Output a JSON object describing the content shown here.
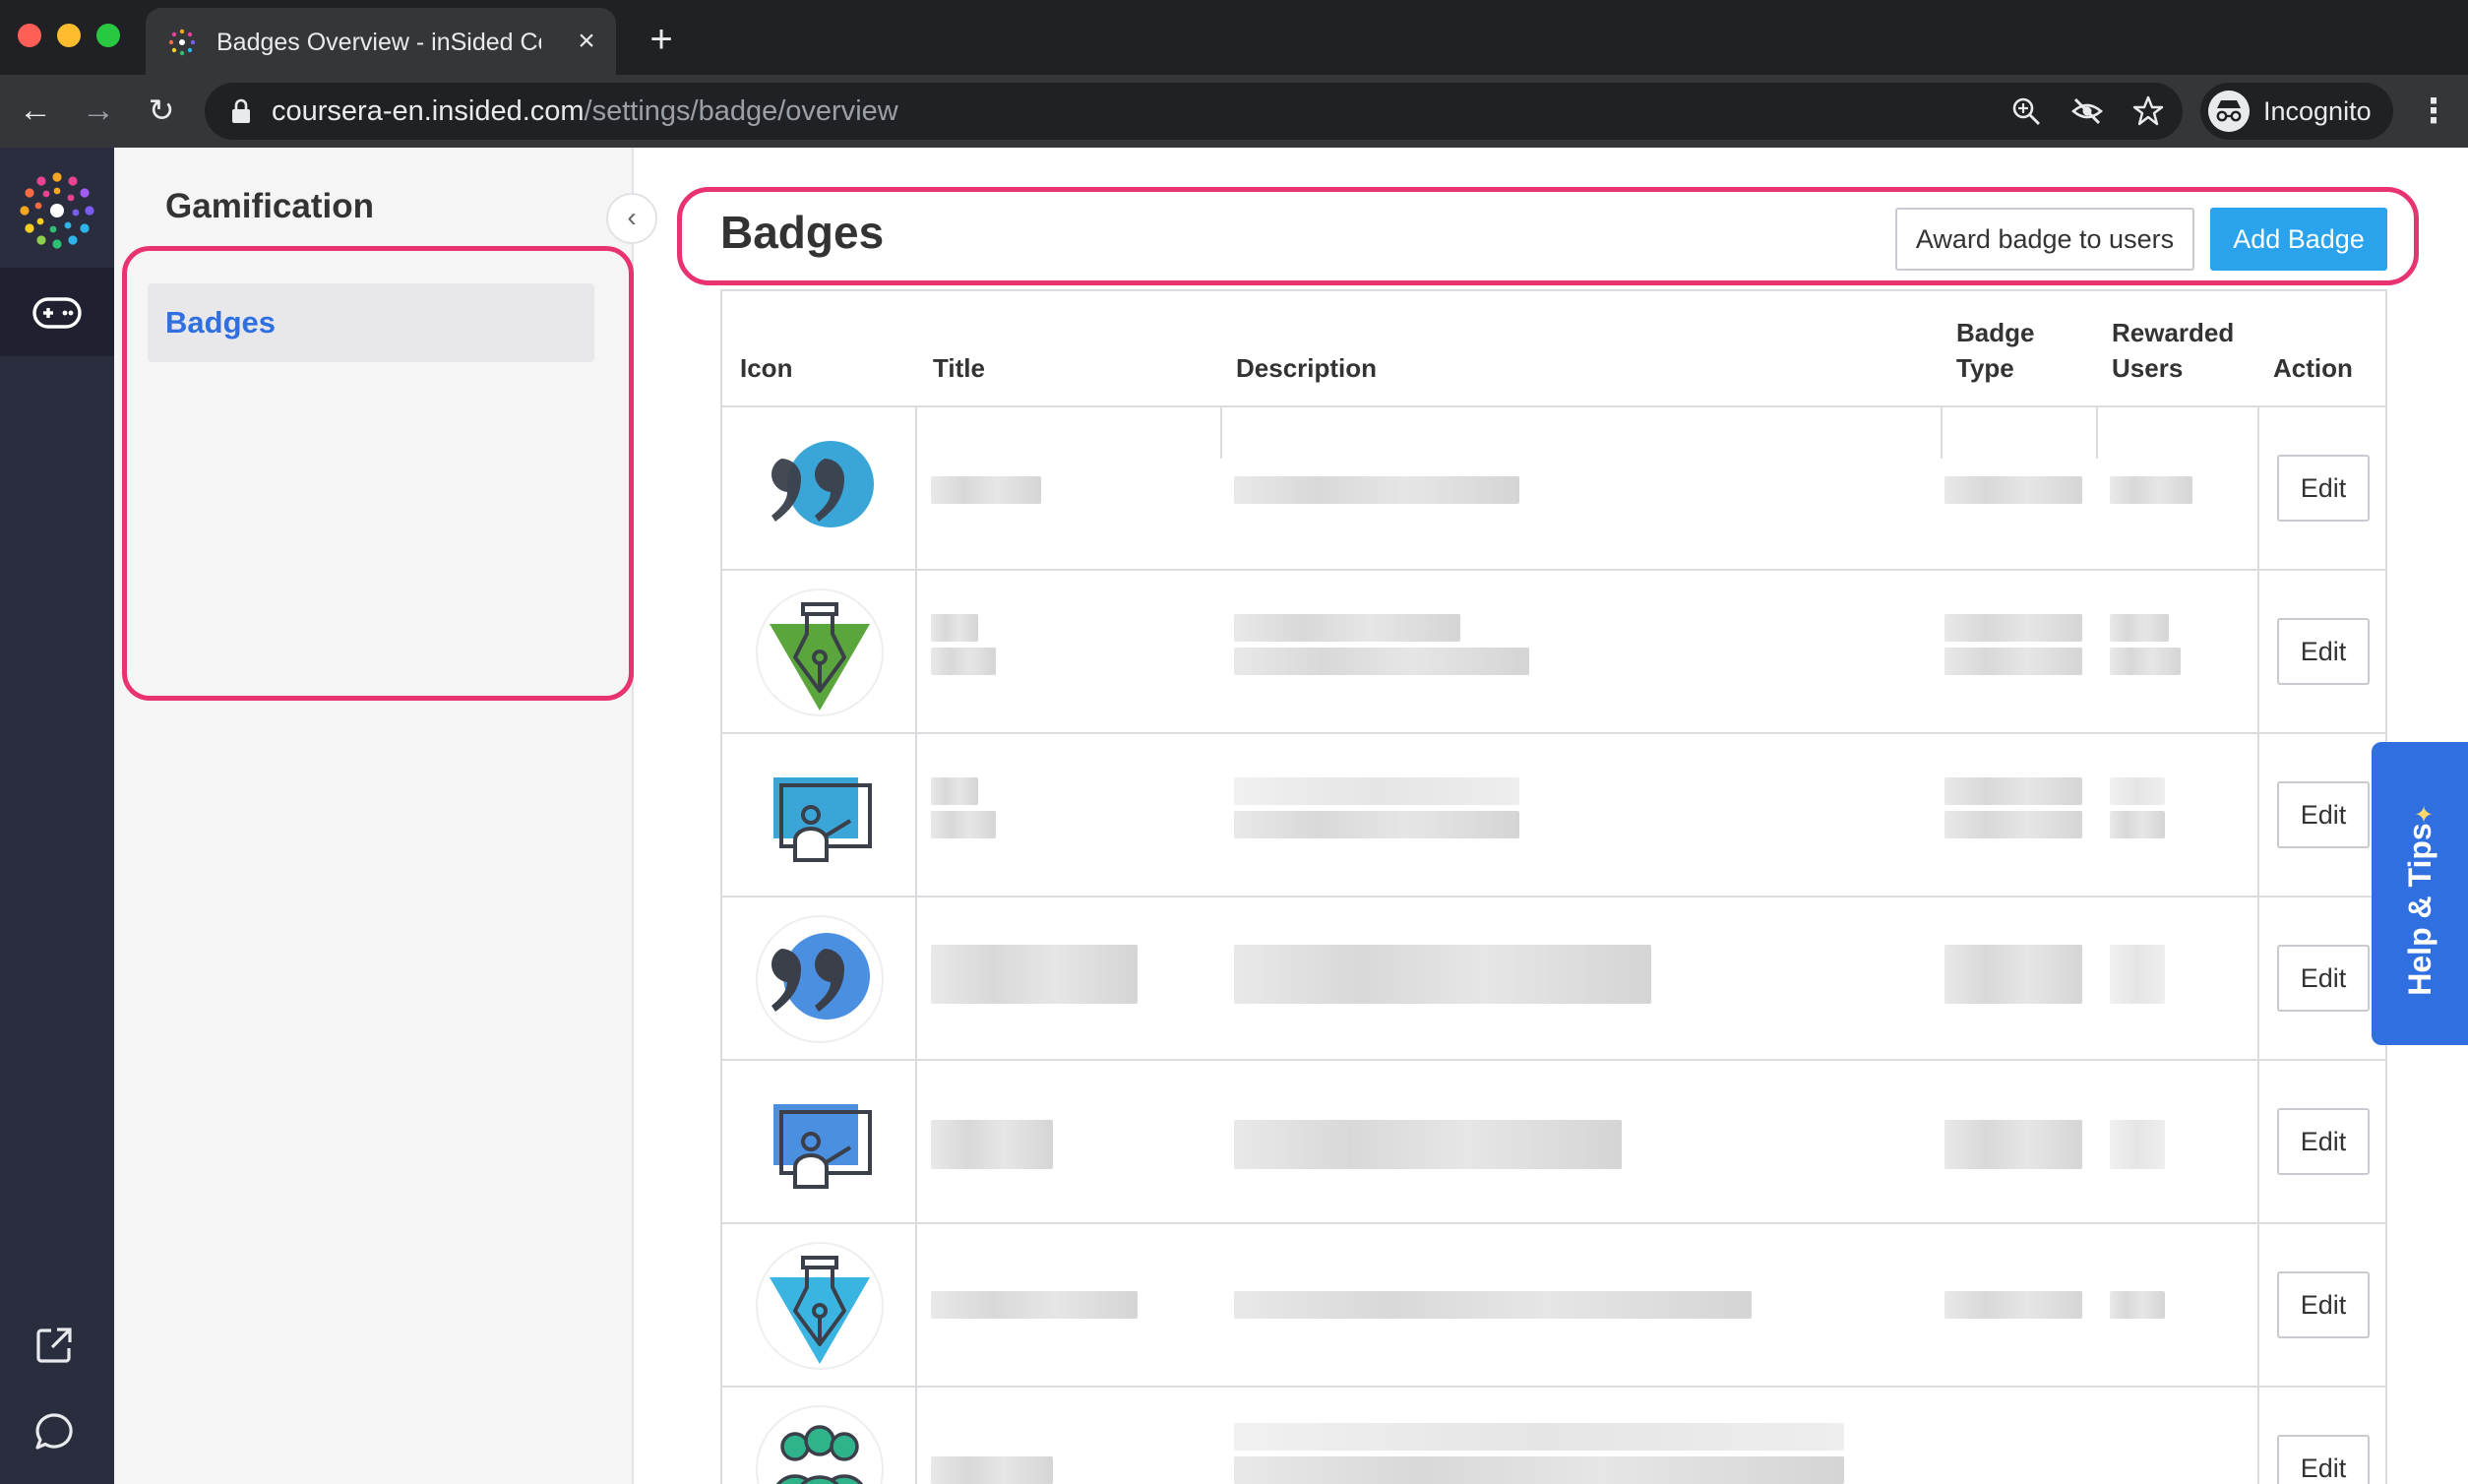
{
  "browser": {
    "tab_title": "Badges Overview - inSided Co",
    "url_host": "coursera-en.insided.com",
    "url_path": "/settings/badge/overview",
    "profile_label": "Incognito"
  },
  "sidebar": {
    "section_title": "Gamification",
    "items": [
      {
        "label": "Badges"
      }
    ]
  },
  "main": {
    "title": "Badges",
    "award_button": "Award badge to users",
    "add_button": "Add Badge"
  },
  "table": {
    "columns": {
      "icon": "Icon",
      "title": "Title",
      "description": "Description",
      "badge_type": "Badge Type",
      "rewarded_users": "Rewarded Users",
      "action": "Action"
    },
    "rows": [
      {
        "icon": "quote-bubble-icon",
        "badge_color": "#3aa6d8",
        "edit_label": "Edit"
      },
      {
        "icon": "pen-nib-icon",
        "badge_color": "#5aa63c",
        "edit_label": "Edit"
      },
      {
        "icon": "presentation-board-icon",
        "badge_color": "#3aa6d8",
        "edit_label": "Edit"
      },
      {
        "icon": "quote-bubble-icon",
        "badge_color": "#4a8fe0",
        "edit_label": "Edit"
      },
      {
        "icon": "presentation-board-icon",
        "badge_color": "#4a8fe0",
        "edit_label": "Edit"
      },
      {
        "icon": "pen-nib-icon",
        "badge_color": "#3ab4e0",
        "edit_label": "Edit"
      },
      {
        "icon": "group-people-icon",
        "badge_color": "#2fb38a",
        "edit_label": "Edit"
      }
    ]
  },
  "help": {
    "label": "Help & Tips"
  },
  "colors": {
    "accent_blue": "#2ba3ec",
    "link_blue": "#2f6fe0",
    "highlight_pink": "#e8336f",
    "rail_bg": "#2a2d3e"
  }
}
